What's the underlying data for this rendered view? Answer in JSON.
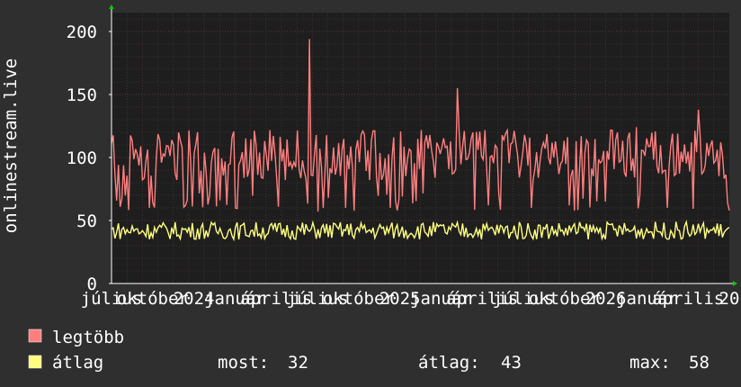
{
  "chart_data": {
    "type": "line",
    "ylabel": "onlinestream.live",
    "ylim": [
      0,
      215
    ],
    "y_ticks": [
      0,
      50,
      100,
      150,
      200
    ],
    "grid": true,
    "x_tick_labels": [
      "július",
      "október",
      "2024",
      "január",
      "április",
      "július",
      "október",
      "2025",
      "január",
      "április",
      "július",
      "október",
      "2026",
      "január",
      "április",
      "20"
    ],
    "series": [
      {
        "name": "legtöbb",
        "color": "#ff7f7f",
        "base": 102,
        "swing": 20,
        "spikes": [
          [
            0.06,
            60
          ],
          [
            0.12,
            62
          ],
          [
            0.2,
            60
          ],
          [
            0.32,
            194
          ],
          [
            0.35,
            68
          ],
          [
            0.38,
            60
          ],
          [
            0.45,
            60
          ],
          [
            0.5,
            112
          ],
          [
            0.56,
            155
          ],
          [
            0.61,
            62
          ],
          [
            0.68,
            60
          ],
          [
            0.74,
            62
          ],
          [
            0.8,
            65
          ],
          [
            0.85,
            124
          ],
          [
            0.9,
            60
          ],
          [
            0.95,
            138
          ],
          [
            1.0,
            58
          ]
        ]
      },
      {
        "name": "átlag",
        "color": "#ffff7f",
        "base": 42,
        "swing": 7
      }
    ],
    "stats": {
      "now_label": "most:",
      "now_value": "32",
      "avg_label": "átlag:",
      "avg_value": "43",
      "max_label": "max:",
      "max_value": "58"
    },
    "colors": {
      "background": "#2f2f2f",
      "plot_background": "#1e1e1e",
      "grid": "#5a3a3a",
      "axis": "#ffffff",
      "arrow": "#00cc00"
    }
  }
}
